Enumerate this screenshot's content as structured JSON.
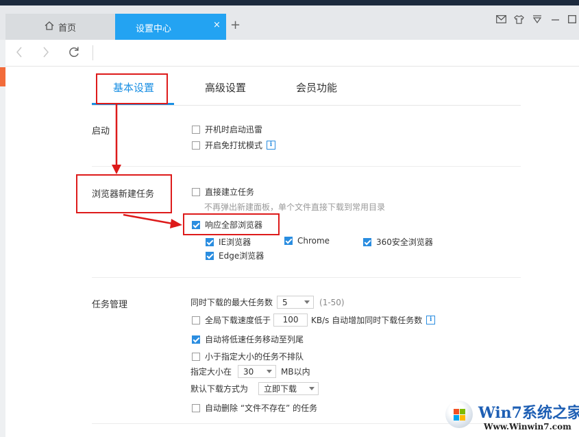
{
  "tabs": {
    "home_label": "首页",
    "settings_label": "设置中心",
    "close_glyph": "×",
    "new_tab_glyph": "+"
  },
  "settings_tabs": [
    {
      "label": "基本设置",
      "active": true
    },
    {
      "label": "高级设置",
      "active": false
    },
    {
      "label": "会员功能",
      "active": false
    }
  ],
  "startup": {
    "title": "启动",
    "options": [
      {
        "label": "开机时启动迅雷",
        "checked": false
      },
      {
        "label": "开启免打扰模式",
        "checked": false
      }
    ]
  },
  "browser": {
    "title": "浏览器新建任务",
    "direct_label": "直接建立任务",
    "direct_desc": "不再弹出新建面板，单个文件直接下载到常用目录",
    "respond_all_label": "响应全部浏览器",
    "browsers": [
      "IE浏览器",
      "Chrome",
      "360安全浏览器",
      "Edge浏览器"
    ]
  },
  "tasks": {
    "title": "任务管理",
    "max_tasks_label": "同时下载的最大任务数",
    "max_tasks_value": "5",
    "max_tasks_range": "(1-50)",
    "speed_label": "全局下载速度低于",
    "speed_value": "100",
    "speed_suffix": "KB/s 自动增加同时下载任务数",
    "move_slow_label": "自动将低速任务移动至列尾",
    "no_queue_label": "小于指定大小的任务不排队",
    "size_label": "指定大小在",
    "size_value": "30",
    "size_suffix": "MB以内",
    "default_method_label": "默认下载方式为",
    "default_method_value": "立即下载",
    "auto_delete_label": "自动删除 “文件不存在” 的任务"
  },
  "watermark": {
    "title": "Win7系统之家",
    "url": "Www.Winwin7.com"
  },
  "colors": {
    "accent": "#1a8fe3",
    "active_tab": "#23a3f2",
    "annotation": "#dd1a1a"
  }
}
